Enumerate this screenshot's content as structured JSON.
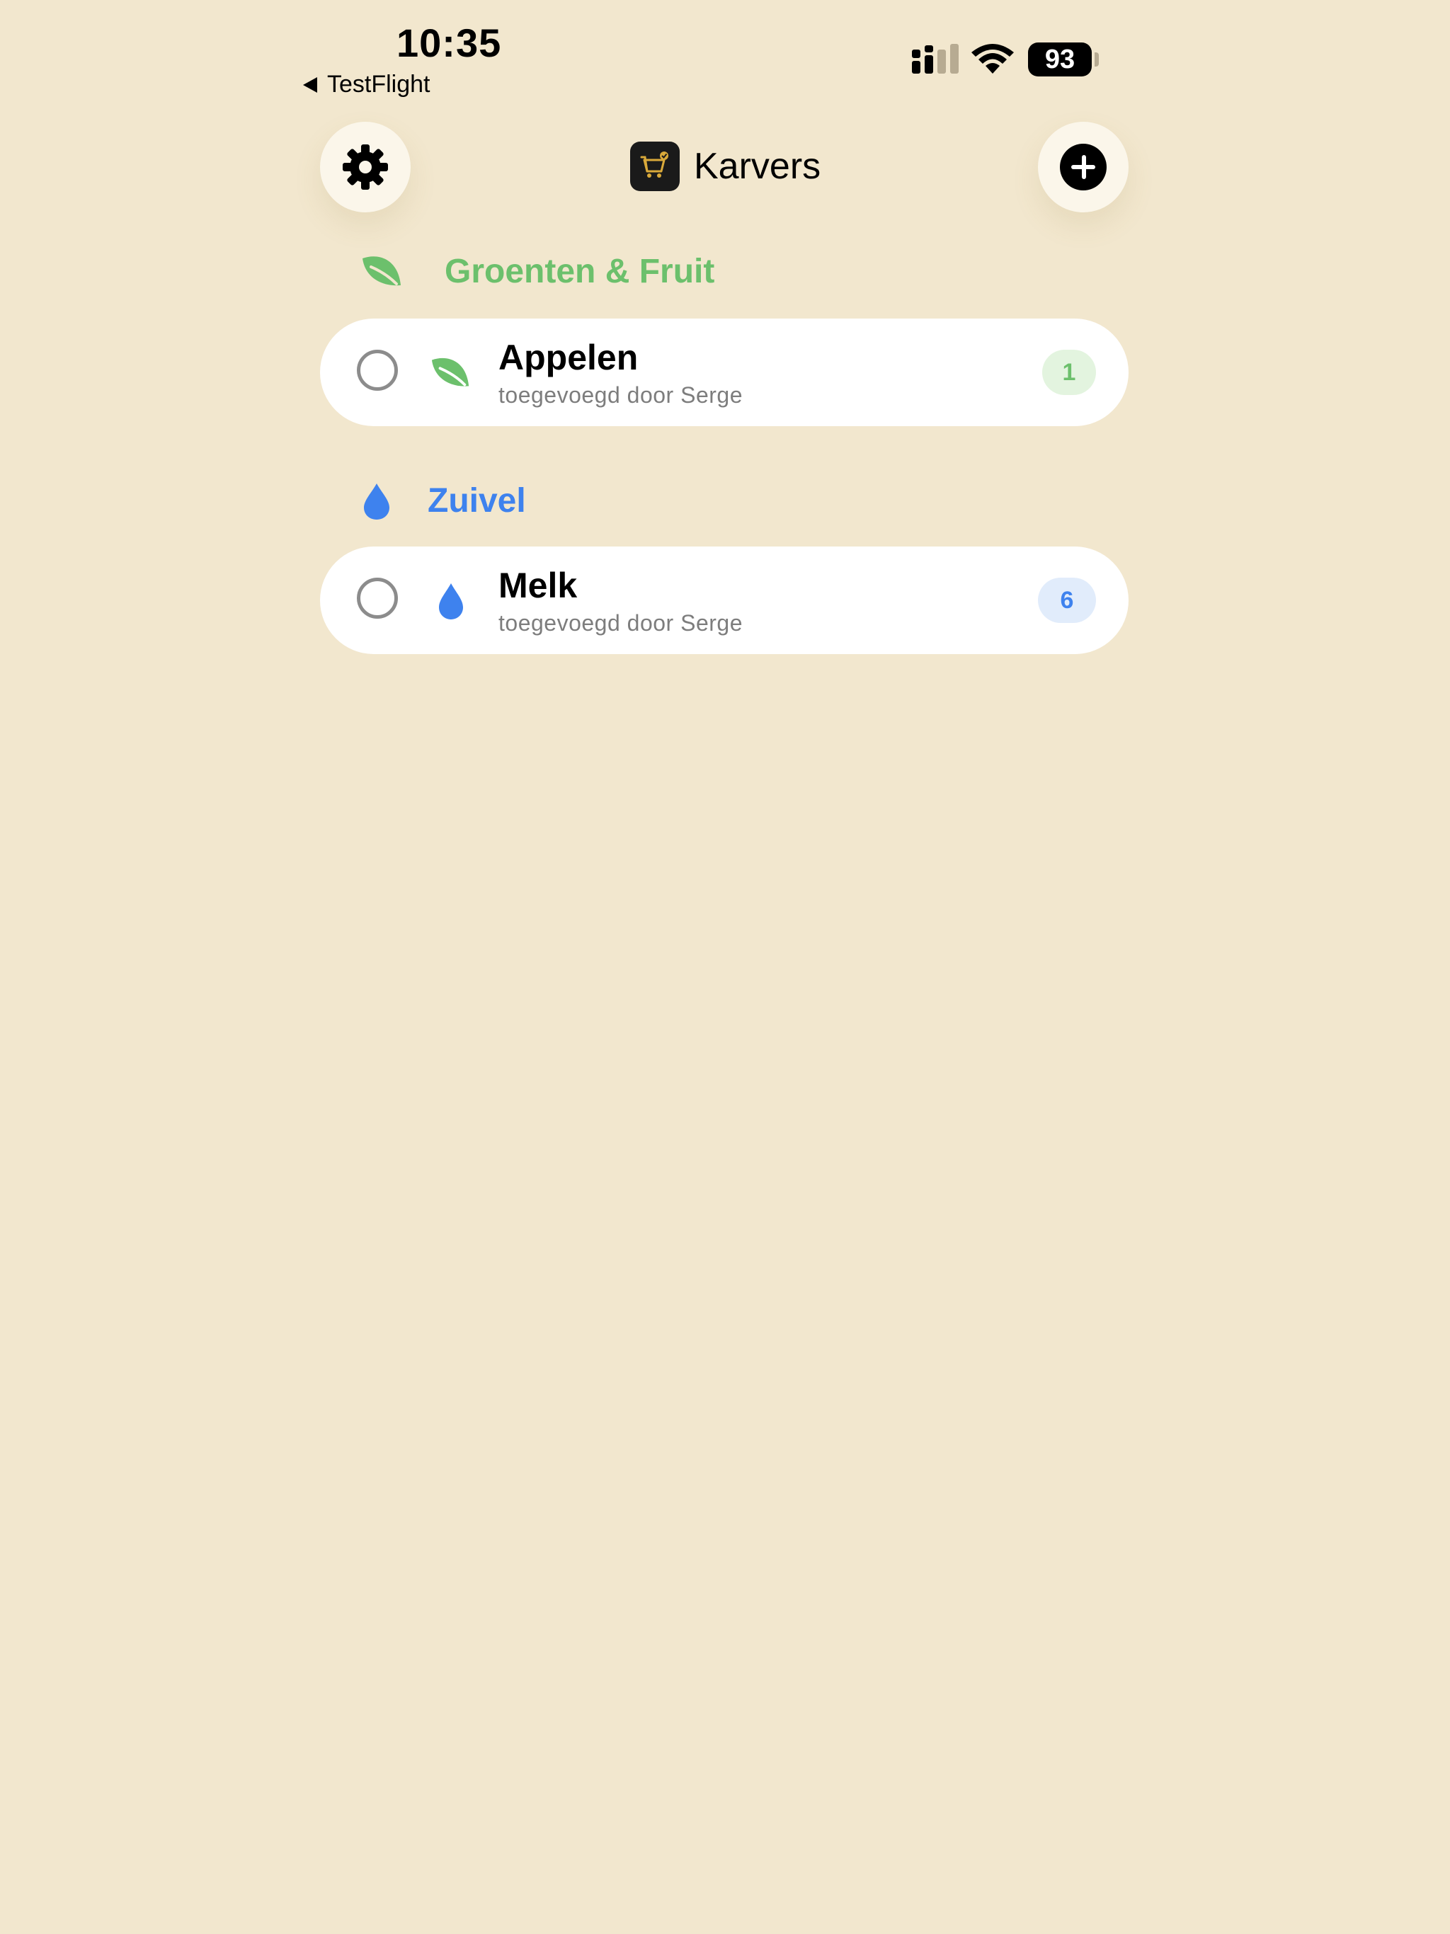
{
  "status_bar": {
    "time": "10:35",
    "back_label": "TestFlight",
    "battery": "93"
  },
  "header": {
    "title": "Karvers",
    "settings_icon": "gear-icon",
    "add_icon": "plus-circle-icon",
    "app_icon": "shopping-cart-icon"
  },
  "sections": [
    {
      "title": "Groenten & Fruit",
      "icon": "leaf-icon",
      "color": "#6CC06C",
      "items": [
        {
          "name": "Appelen",
          "subtitle": "toegevoegd door Serge",
          "quantity": "1"
        }
      ]
    },
    {
      "title": "Zuivel",
      "icon": "drop-icon",
      "color": "#3E82EE",
      "items": [
        {
          "name": "Melk",
          "subtitle": "toegevoegd door Serge",
          "quantity": "6"
        }
      ]
    }
  ],
  "colors": {
    "background": "#F2E7CE",
    "card": "#FFFFFF",
    "green": "#6CC06C",
    "blue": "#3E82EE"
  }
}
